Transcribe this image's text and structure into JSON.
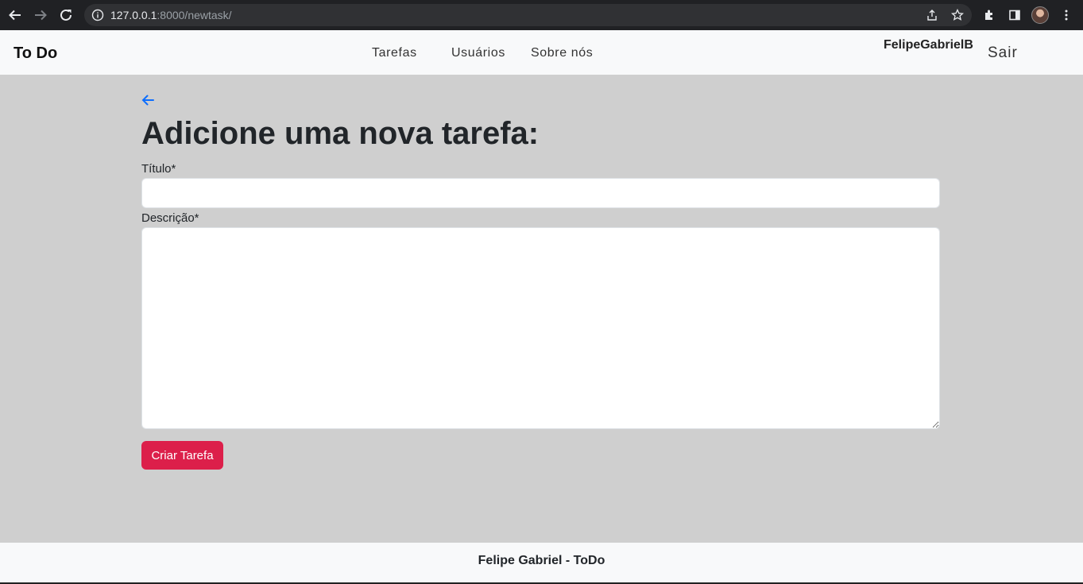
{
  "browser": {
    "url_host": "127.0.0.1",
    "url_path": ":8000/newtask/",
    "icons": [
      "back-arrow-icon",
      "forward-arrow-icon",
      "reload-icon",
      "info-icon",
      "share-icon",
      "star-icon",
      "extensions-icon",
      "side-panel-icon",
      "profile-avatar",
      "more-menu-icon"
    ]
  },
  "navbar": {
    "brand": "To Do",
    "links": [
      "Tarefas",
      "Usuários",
      "Sobre nós"
    ],
    "username": "FelipeGabrielB",
    "logout": "Sair"
  },
  "form": {
    "title": "Adicione uma nova tarefa:",
    "title_label": "Título*",
    "title_value": "",
    "description_label": "Descrição*",
    "description_value": "",
    "submit_label": "Criar Tarefa"
  },
  "footer": {
    "text": "Felipe Gabriel - ToDo"
  },
  "colors": {
    "page_background": "#cfcfcf",
    "navbar_background": "#f8f9fa",
    "submit_button": "#dc1f4a",
    "back_arrow": "#0d6efd"
  }
}
